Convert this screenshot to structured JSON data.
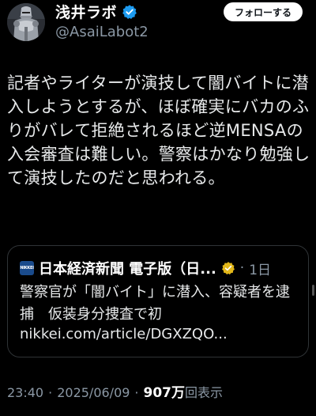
{
  "author": {
    "display_name": "浅井ラボ",
    "handle": "@AsaiLabot2",
    "avatar_icon": "knight-armor-avatar",
    "verified_icon": "blue-verified-badge"
  },
  "follow_label": "フォローする",
  "tweet_text": "記者やライターが演技して闇バイトに潜入しようとするが、ほぼ確実にバカのふりがバレて拒絶されるほど逆MENSAの入会審査は難しい。警察はかなり勉強して演技したのだと思われる。",
  "quoted": {
    "logo_text": "NIKKEI",
    "name": "日本経済新聞 電子版（日...",
    "badge_icon": "gold-verified-badge",
    "separator": "·",
    "time": "1日",
    "body": "警察官が「闇バイト」に潜入、容疑者を逮捕　仮装身分捜査で初",
    "link": "nikkei.com/article/DGXZQO..."
  },
  "meta": {
    "time": "23:40",
    "dot": "·",
    "date": "2025/06/09",
    "dot2": "·",
    "views": "907万",
    "views_suffix": "回表示"
  },
  "colors": {
    "background": "#000000",
    "text": "#e7e9ea",
    "secondary": "#8b98a5",
    "verified_blue": "#1d9bf0",
    "verified_gold": "#e2b719"
  }
}
